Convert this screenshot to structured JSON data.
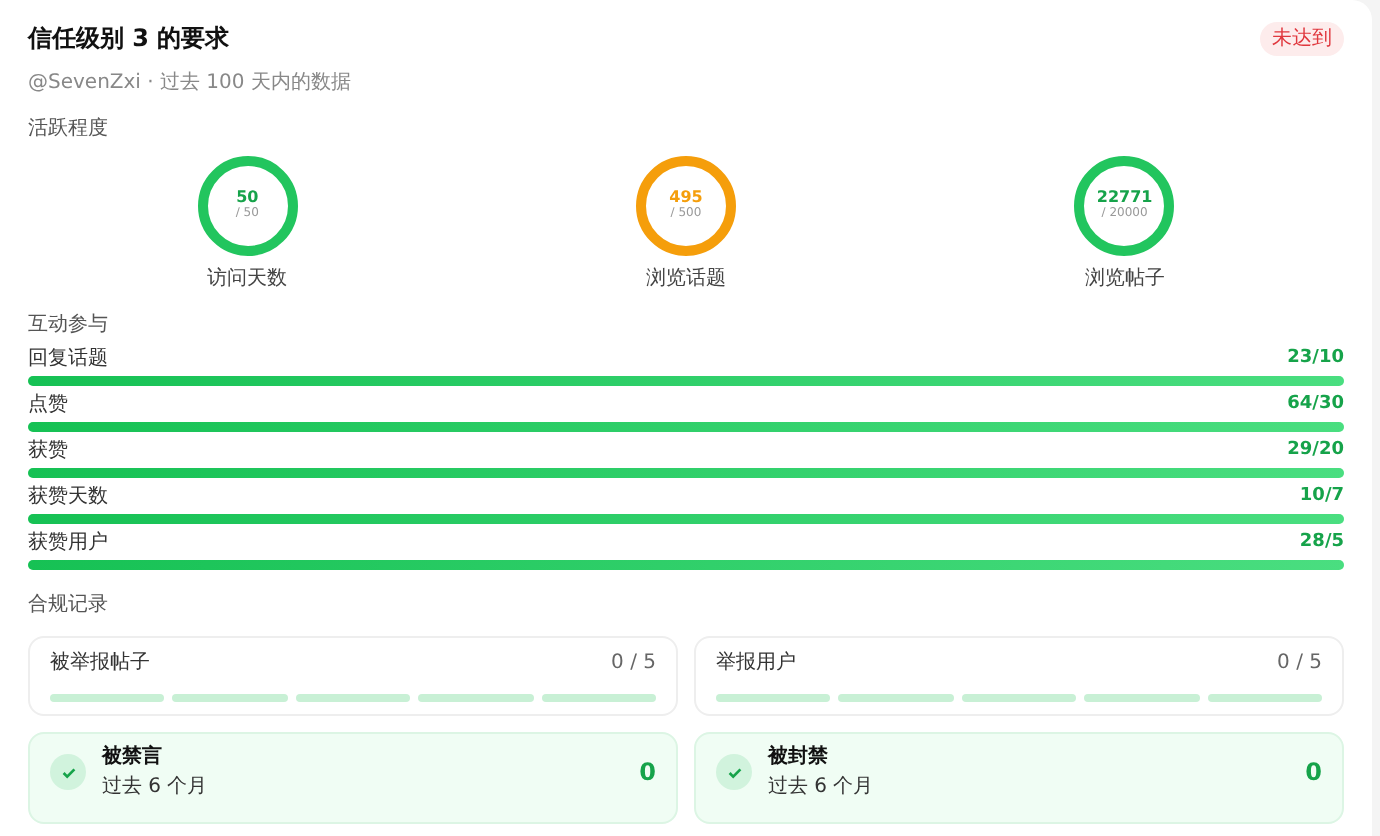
{
  "header": {
    "title": "信任级别 3 的要求",
    "status": "未达到",
    "met": false,
    "subtitle": "@SevenZxi · 过去 100 天内的数据"
  },
  "activity": {
    "heading": "活跃程度",
    "rings": [
      {
        "value": "50",
        "target": "/ 50",
        "label": "访问天数",
        "met": true
      },
      {
        "value": "495",
        "target": "/ 500",
        "label": "浏览话题",
        "met": false
      },
      {
        "value": "22771",
        "target": "/ 20000",
        "label": "浏览帖子",
        "met": true
      }
    ]
  },
  "engagement": {
    "heading": "互动参与",
    "rows": [
      {
        "label": "回复话题",
        "reading": "23/10",
        "level": 1
      },
      {
        "label": "点赞",
        "reading": "64/30",
        "level": 1
      },
      {
        "label": "获赞",
        "reading": "29/20",
        "level": 1
      },
      {
        "label": "获赞天数",
        "reading": "10/7",
        "level": 1
      },
      {
        "label": "获赞用户",
        "reading": "28/5",
        "level": 1
      }
    ]
  },
  "compliance": {
    "heading": "合规记录",
    "reports": [
      {
        "label": "被举报帖子",
        "reading": "0 / 5"
      },
      {
        "label": "举报用户",
        "reading": "0 / 5"
      }
    ],
    "records": [
      {
        "title": "被禁言",
        "period": "过去 6 个月",
        "value": "0",
        "met": true
      },
      {
        "title": "被封禁",
        "period": "过去 6 个月",
        "value": "0",
        "met": true
      }
    ]
  }
}
